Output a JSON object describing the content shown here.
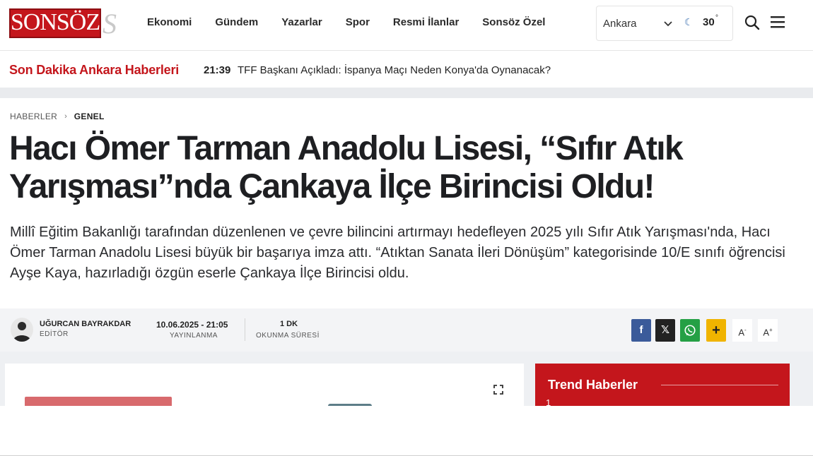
{
  "brand": {
    "logo_text": "SONSÖZ",
    "accent": "#c4161c"
  },
  "nav": {
    "items": [
      {
        "label": "Ekonomi"
      },
      {
        "label": "Gündem"
      },
      {
        "label": "Yazarlar"
      },
      {
        "label": "Spor"
      },
      {
        "label": "Resmi İlanlar"
      },
      {
        "label": "Sonsöz Özel"
      }
    ]
  },
  "weather": {
    "city": "Ankara",
    "temperature": "30",
    "degree_symbol": "°",
    "icon": "moon-icon"
  },
  "header_icons": {
    "search": "search-icon",
    "menu": "hamburger-menu-icon"
  },
  "breaking": {
    "label": "Son Dakika Ankara Haberleri",
    "time": "21:39",
    "headline": "TFF Başkanı Açıkladı: İspanya Maçı Neden Konya'da Oynanacak?"
  },
  "breadcrumb": {
    "root": "HABERLER",
    "separator": "›",
    "current": "GENEL"
  },
  "article": {
    "title": "Hacı Ömer Tarman Anadolu Lisesi, “Sıfır Atık Yarışması”nda Çankaya İlçe Birincisi Oldu!",
    "lead": "Millî Eğitim Bakanlığı tarafından düzenlenen ve çevre bilincini artırmayı hedefleyen 2025 yılı Sıfır Atık Yarışması'nda, Hacı Ömer Tarman Anadolu Lisesi büyük bir başarıya imza attı. “Atıktan Sanata İleri Dönüşüm” kategorisinde 10/E sınıfı öğrencisi Ayşe Kaya, hazırladığı özgün eserle Çankaya İlçe Birincisi oldu."
  },
  "meta": {
    "author_name": "UĞURCAN BAYRAKDAR",
    "author_role": "EDİTÖR",
    "published": "10.06.2025 - 21:05",
    "published_label": "YAYINLANMA",
    "read_time": "1 DK",
    "read_time_label": "OKUNMA SÜRESİ"
  },
  "share": {
    "facebook": "f",
    "x": "𝕏",
    "whatsapp": "whatsapp-icon",
    "more": "+",
    "font_smaller": "A",
    "font_smaller_sign": "-",
    "font_larger": "A",
    "font_larger_sign": "+",
    "colors": {
      "facebook": "#3b5b9a",
      "x": "#222222",
      "whatsapp": "#25a045",
      "more": "#f0b400"
    }
  },
  "sidebar": {
    "trend_title": "Trend Haberler",
    "first_number": "1"
  }
}
